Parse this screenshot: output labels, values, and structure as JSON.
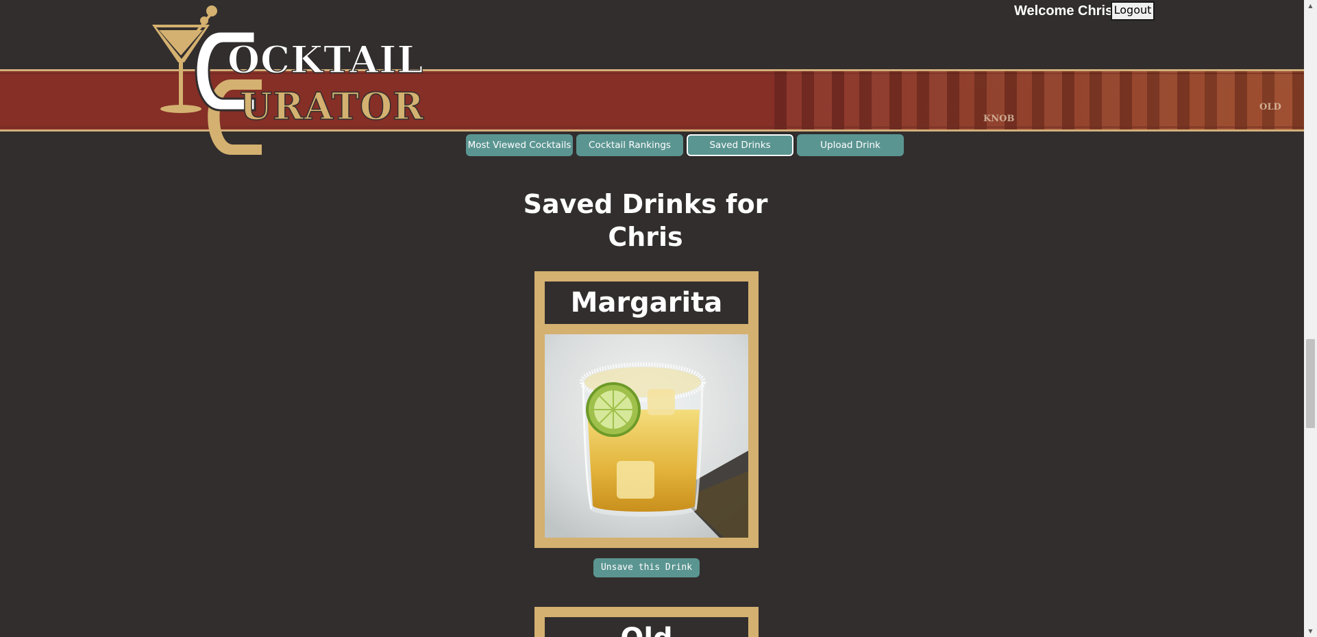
{
  "app": {
    "logo_text_line1": "OCKTAIL",
    "logo_text_line2": "URATOR",
    "logo_initial": "C"
  },
  "header": {
    "welcome_text": "Welcome Chris",
    "logout_label": "Logout"
  },
  "nav": {
    "items": [
      {
        "label": "Most Viewed Cocktails",
        "active": false
      },
      {
        "label": "Cocktail Rankings",
        "active": false
      },
      {
        "label": "Saved Drinks",
        "active": true
      },
      {
        "label": "Upload Drink",
        "active": false
      }
    ]
  },
  "main": {
    "title": "Saved Drinks for Chris",
    "drinks": [
      {
        "name": "Margarita",
        "action_label": "Unsave this Drink"
      },
      {
        "name": "Old Fashioned"
      }
    ]
  },
  "banner": {
    "bottle_labels": [
      "KNOB",
      "OLD"
    ]
  },
  "colors": {
    "background": "#322e2e",
    "banner_red": "#852f27",
    "gold": "#d4b170",
    "teal_button": "#5b9591"
  }
}
